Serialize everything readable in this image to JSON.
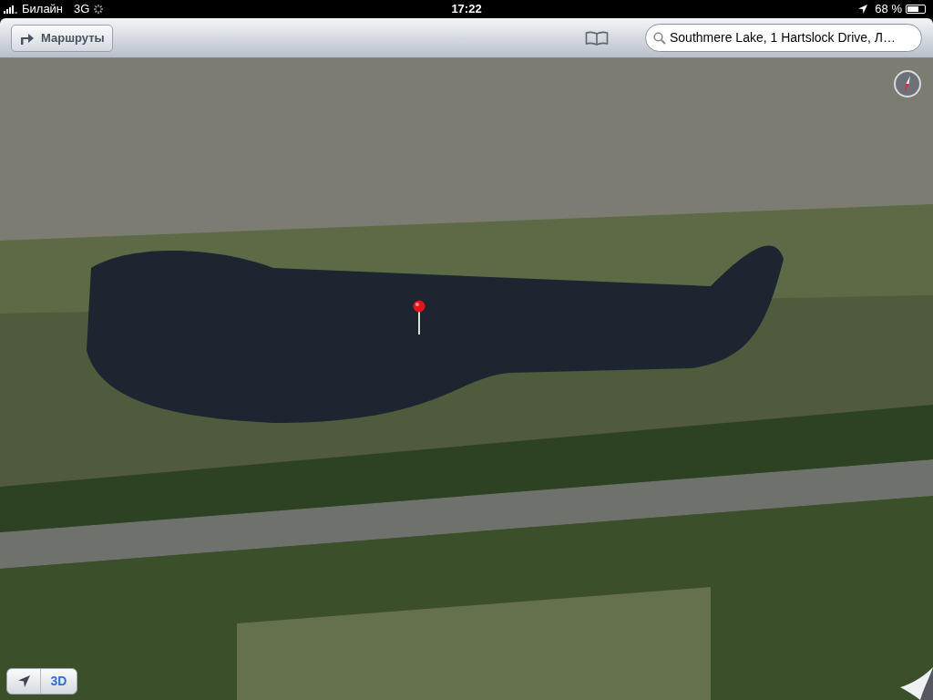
{
  "status_bar": {
    "carrier": "Билайн",
    "network": "3G",
    "time": "17:22",
    "battery": "68 %"
  },
  "toolbar": {
    "directions_button": "Маршруты",
    "search": {
      "value": "Southmere Lake, 1 Hartslock Drive, Л…"
    }
  },
  "map": {
    "mode_button": {
      "label": "3D",
      "selected": true
    }
  }
}
